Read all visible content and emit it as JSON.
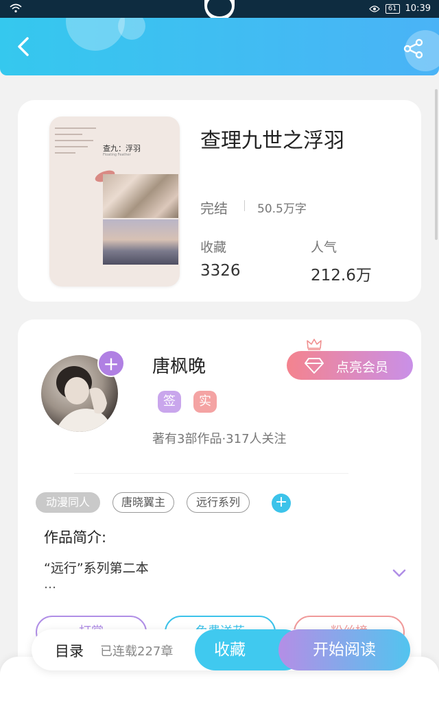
{
  "status_bar": {
    "battery": "61",
    "time": "10:39"
  },
  "book": {
    "cover_title": "查九：浮羽",
    "cover_subtitle": "Floating Feather",
    "title": "查理九世之浮羽",
    "status": "完结",
    "words": "50.5万字",
    "favorites_label": "收藏",
    "favorites_value": "3326",
    "popularity_label": "人气",
    "popularity_value": "212.6万"
  },
  "author": {
    "name": "唐枫晚",
    "badge_sign": "签",
    "badge_real": "实",
    "meta": "著有3部作品·317人关注",
    "vip_label": "点亮会员"
  },
  "tags": {
    "main": "动漫同人",
    "items": [
      "唐晓翼主",
      "远行系列"
    ]
  },
  "intro": {
    "label": "作品简介:",
    "text": "“远行”系列第二本",
    "ellipsis": "…"
  },
  "actions": [
    "打赏",
    "免费送花",
    "粉丝榜"
  ],
  "bottom": {
    "toc_label": "目录",
    "toc_sub": "已连载227章",
    "favorite_button": "收藏",
    "read_button": "开始阅读"
  },
  "colors": {
    "header": "#35c8ee",
    "vip": "#f4838e",
    "accent_purple": "#b080e3",
    "accent_cyan": "#40c9ef"
  },
  "icons": [
    "wifi-icon",
    "eye-icon",
    "back-icon",
    "share-icon",
    "plus-icon",
    "diamond-icon",
    "crown-icon",
    "chevron-down-icon"
  ]
}
